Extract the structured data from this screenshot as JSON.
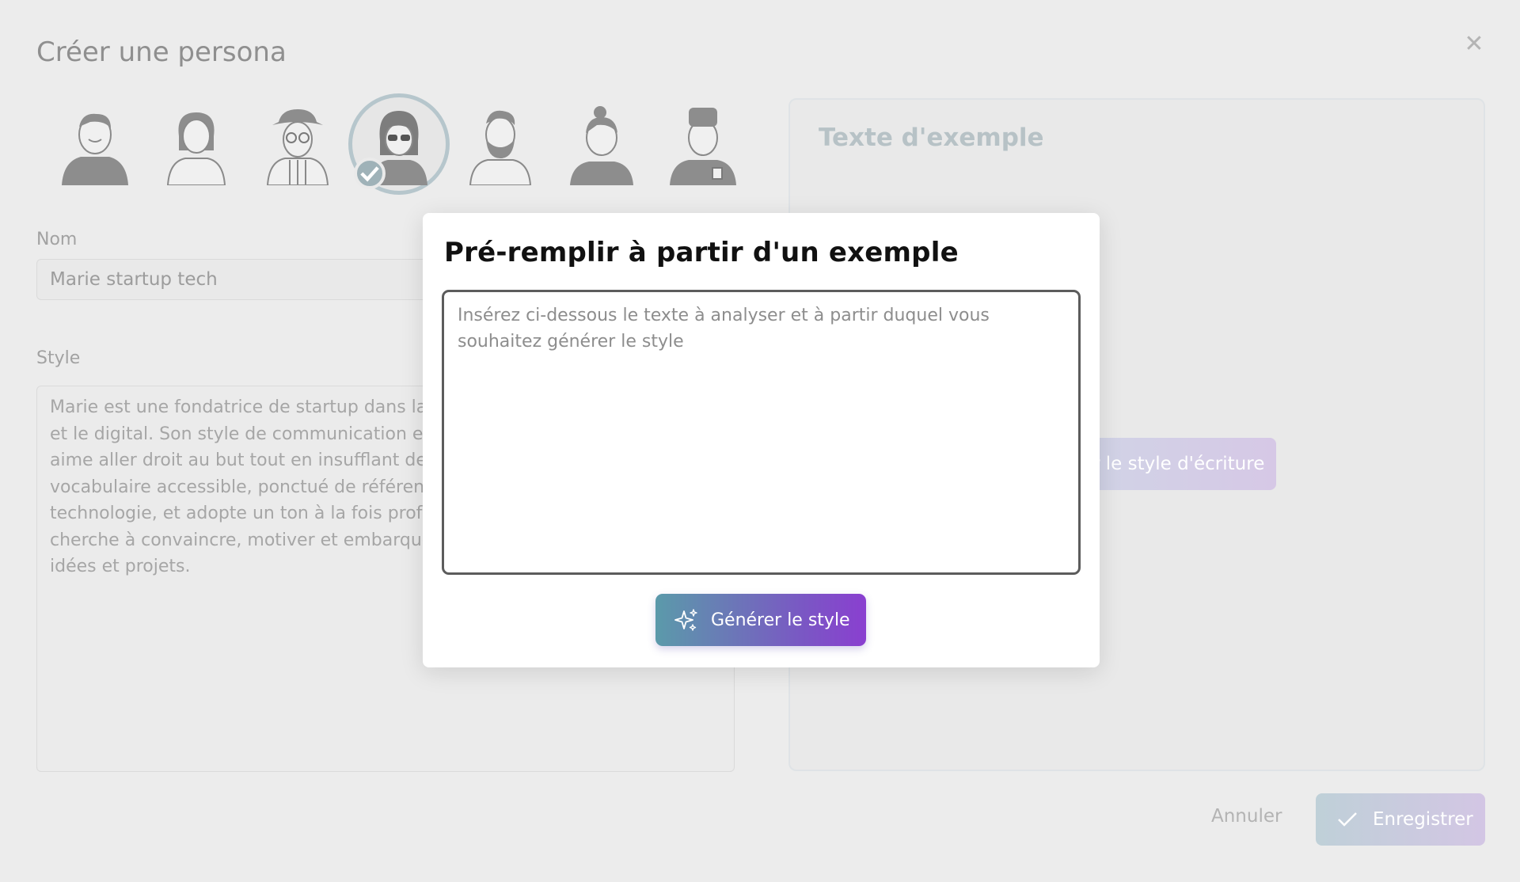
{
  "background_dialog": {
    "title": "Créer une persona",
    "avatars": [
      {
        "name": "man-tshirt",
        "selected": false
      },
      {
        "name": "woman-shirt",
        "selected": false
      },
      {
        "name": "man-hat-glasses",
        "selected": false
      },
      {
        "name": "woman-sunglasses",
        "selected": true
      },
      {
        "name": "bearded-man",
        "selected": false
      },
      {
        "name": "woman-bun",
        "selected": false
      },
      {
        "name": "man-coffee",
        "selected": false
      }
    ],
    "name_label": "Nom",
    "name_value": "Marie startup tech",
    "style_label": "Style",
    "style_value": "Marie est une fondatrice de startup dans la\net le digital. Son style de communication es\naime aller droit au but tout en insufflant de l\nvocabulaire accessible, ponctué de référenc\ntechnologie, et adopte un ton à la fois profe\ncherche à convaincre, motiver et embarque\nidées et projets.",
    "preview_title": "Texte d'exemple",
    "analyze_button_visible_text": "r le style d'écriture",
    "cancel_label": "Annuler",
    "save_label": "Enregistrer"
  },
  "modal": {
    "title": "Pré-remplir à partir d'un exemple",
    "textarea_placeholder": "Insérez ci-dessous le texte à analyser et à partir duquel vous souhaitez générer le style",
    "textarea_value": "",
    "generate_label": "Générer le style"
  },
  "colors": {
    "overlay_background": "#ececec",
    "modal_background": "#ffffff",
    "generate_gradient_start": "#5b9aaa",
    "generate_gradient_end": "#8a3fd0"
  }
}
